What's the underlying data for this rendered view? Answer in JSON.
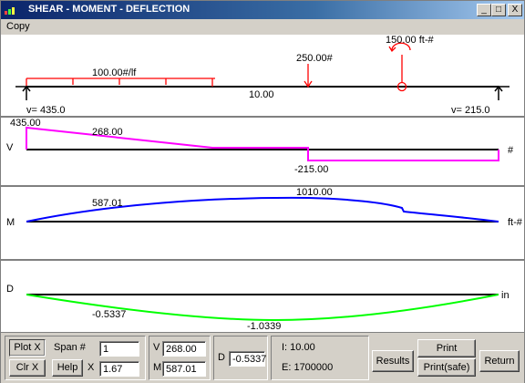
{
  "window": {
    "title": "SHEAR - MOMENT - DEFLECTION",
    "minimize_label": "_",
    "maximize_label": "□",
    "close_label": "X"
  },
  "menu": {
    "copy_label": "Copy"
  },
  "beam": {
    "distributed_load_label": "100.00#/lf",
    "point_load_label": "250.00#",
    "moment_label": "150.00 ft-#",
    "span_label": "10.00",
    "left_reaction_label": "v= 435.0",
    "right_reaction_label": "v= 215.0"
  },
  "shear_diagram": {
    "axis_label": "V",
    "unit_label": "#",
    "value_labels": [
      "435.00",
      "268.00",
      "-215.00"
    ]
  },
  "moment_diagram": {
    "axis_label": "M",
    "unit_label": "ft-#",
    "value_labels": [
      "587.01",
      "1010.00"
    ]
  },
  "deflection_diagram": {
    "axis_label": "D",
    "unit_label": "in",
    "value_labels": [
      "-0.5337",
      "-1.0339"
    ]
  },
  "controls": {
    "plot_x_label": "Plot X",
    "clr_x_label": "Clr X",
    "span_label": "Span #",
    "span_value": "1",
    "help_label": "Help",
    "x_label": "X",
    "x_value": "1.67",
    "v_label": "V",
    "v_value": "268.00",
    "m_label": "M",
    "m_value": "587.01",
    "d_label": "D",
    "d_value": "-0.5337",
    "i_text": "I: 10.00",
    "e_text": "E: 1700000",
    "results_label": "Results",
    "print_label": "Print",
    "print_safe_label": "Print(safe)",
    "return_label": "Return"
  },
  "colors": {
    "title_bar": "#0a246a",
    "load": "#ff0000",
    "shear": "#ff00ff",
    "moment": "#0000ff",
    "deflection": "#00ff00",
    "beam": "#000000"
  }
}
